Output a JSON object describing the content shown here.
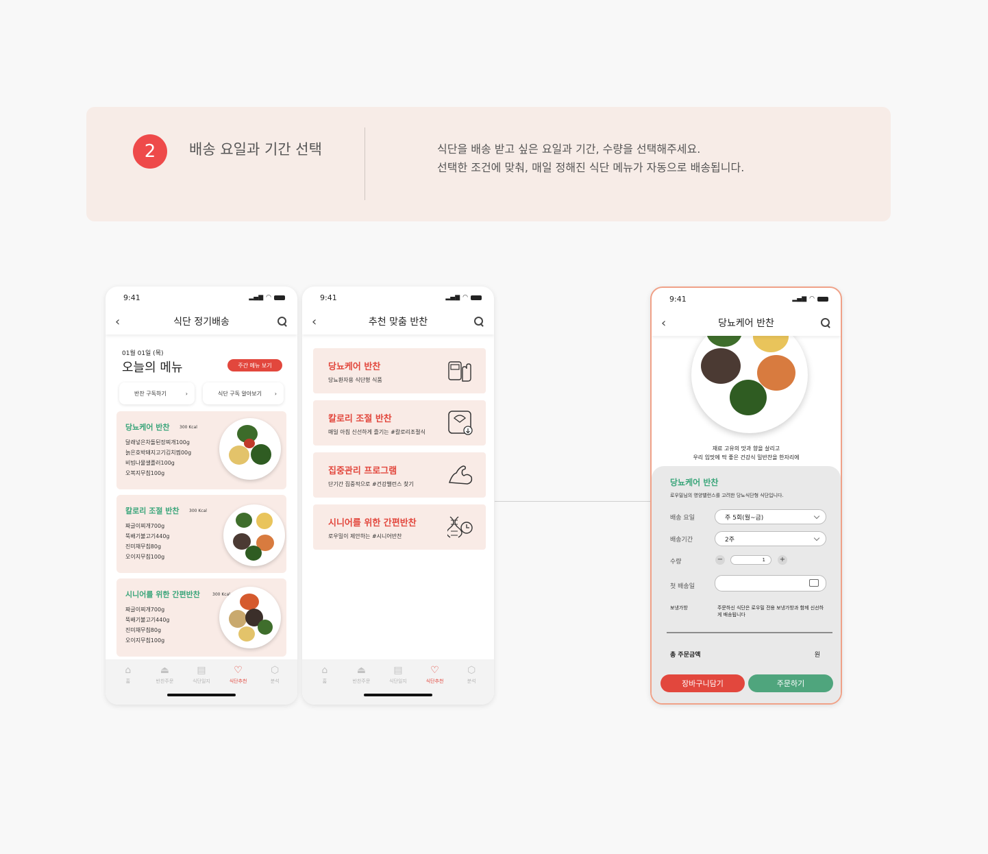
{
  "step": {
    "number": "2",
    "title": "배송 요일과 기간 선택",
    "desc_line1": "식단을 배송 받고 싶은 요일과 기간, 수량을 선택해주세요.",
    "desc_line2": "선택한 조건에 맞춰, 매일 정해진 식단 메뉴가 자동으로 배송됩니다."
  },
  "status_time": "9:41",
  "tabbar": {
    "items": [
      {
        "label": "홈",
        "icon": "home-icon"
      },
      {
        "label": "반찬주문",
        "icon": "cloche-icon"
      },
      {
        "label": "식단일지",
        "icon": "journal-icon"
      },
      {
        "label": "식단추천",
        "icon": "heart-icon"
      },
      {
        "label": "분석",
        "icon": "analysis-icon"
      }
    ]
  },
  "phone1": {
    "nav_title": "식단 정기배송",
    "date": "01월 01일 (목)",
    "today_title": "오늘의 메뉴",
    "week_button": "주간 메뉴 보기",
    "subscribe_button": "반찬 구독하기",
    "info_button": "식단 구독 알아보기",
    "meals": [
      {
        "name": "당뇨케어 반찬",
        "kcal": "300 Kcal",
        "items": [
          "달래넣은차돌된장찌개100g",
          "늙은호박돼지고기김치찜00g",
          "비빔나물샐플러100g",
          "오복지무침100g"
        ]
      },
      {
        "name": "칼로리 조절 반찬",
        "kcal": "300 Kcal",
        "items": [
          "짜글이찌개700g",
          "뚝배기불고기440g",
          "진미채무침80g",
          "오이지무침100g"
        ]
      },
      {
        "name": "시니어를 위한 간편반찬",
        "kcal": "300 Kcal",
        "items": [
          "짜글이찌개700g",
          "뚝배기불고기440g",
          "진미채무침80g",
          "오이지무침100g"
        ]
      }
    ]
  },
  "phone2": {
    "nav_title": "추천 맞춤 반찬",
    "cards": [
      {
        "title": "당뇨케어 반찬",
        "desc": "당뇨환자용 식단형 식품",
        "icon": "glucose-meter-icon"
      },
      {
        "title": "칼로리 조절 반찬",
        "desc": "매일 아침 신선하게 즐기는 #칼로리조절식",
        "icon": "scale-icon"
      },
      {
        "title": "집중관리 프로그램",
        "desc": "단기간 집중적으로 #건강밸런스 찾기",
        "icon": "muscle-arm-icon"
      },
      {
        "title": "시니어를 위한 간편반찬",
        "desc": "로우밀이 제안하는 #시니어반찬",
        "icon": "dna-clock-icon"
      }
    ]
  },
  "phone3": {
    "nav_title": "당뇨케어 반찬",
    "tagline1": "재료 고유의 맛과 향을 살리고",
    "tagline2": "우리 입맛에 딱 좋은 건강식 밀반찬을 한자리에",
    "panel_title": "당뇨케어 반찬",
    "panel_desc": "로우밀님의 영양밸런스를 고려한 당뇨식단형 식단입니다.",
    "delivery_day_label": "배송 요일",
    "delivery_day_value": "주 5회(월~금)",
    "period_label": "배송기간",
    "period_value": "2주",
    "qty_label": "수량",
    "qty_value": "1",
    "first_date_label": "첫 배송일",
    "first_date_value": "",
    "packaging_label": "보냉가방",
    "packaging_text": "주문하신 식단은 로우밀 전용 보냉가방과 함께 신선하게 배송됩니다",
    "total_label": "총 주문금액",
    "total_unit": "원",
    "cart_button": "장바구니담기",
    "order_button": "주문하기"
  },
  "colors": {
    "accent_red": "#e2473d",
    "accent_green": "#3aa57a",
    "card_bg": "#f9ebe6"
  }
}
